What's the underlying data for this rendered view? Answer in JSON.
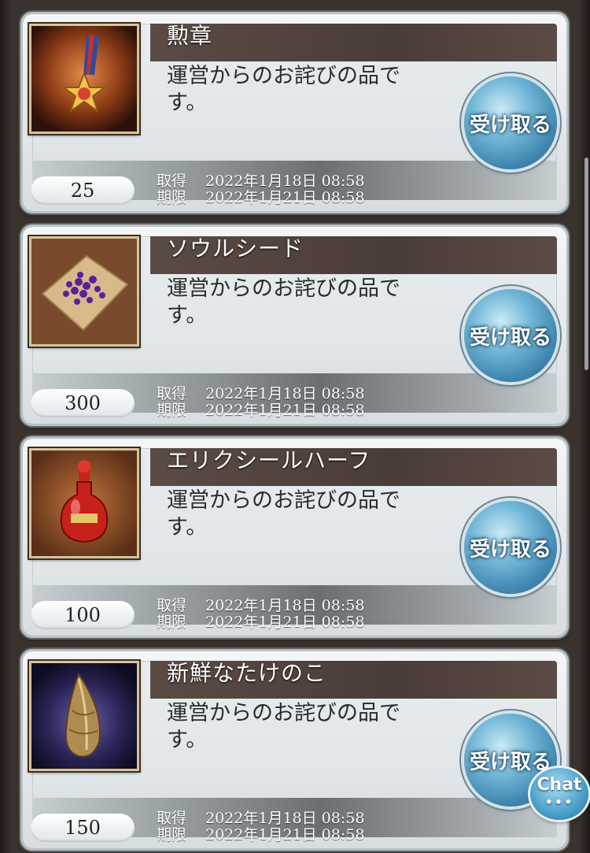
{
  "items": [
    {
      "name": "勲章",
      "description": "運営からのお詫びの品で\nす。",
      "count": "25",
      "acquired_label": "取得",
      "acquired_date": "2022年1月18日 08:58",
      "expiry_label": "期限",
      "expiry_date": "2022年1月21日 08:58",
      "claim_label": "受け取る",
      "icon": "medal-icon"
    },
    {
      "name": "ソウルシード",
      "description": "運営からのお詫びの品で\nす。",
      "count": "300",
      "acquired_label": "取得",
      "acquired_date": "2022年1月18日 08:58",
      "expiry_label": "期限",
      "expiry_date": "2022年1月21日 08:58",
      "claim_label": "受け取る",
      "icon": "soul-seed-icon"
    },
    {
      "name": "エリクシールハーフ",
      "description": "運営からのお詫びの品で\nす。",
      "count": "100",
      "acquired_label": "取得",
      "acquired_date": "2022年1月18日 08:58",
      "expiry_label": "期限",
      "expiry_date": "2022年1月21日 08:58",
      "claim_label": "受け取る",
      "icon": "elixir-bottle-icon"
    },
    {
      "name": "新鮮なたけのこ",
      "description": "運営からのお詫びの品で\nす。",
      "count": "150",
      "acquired_label": "取得",
      "acquired_date": "2022年1月18日 08:58",
      "expiry_label": "期限",
      "expiry_date": "2022年1月21日 08:58",
      "claim_label": "受け取る",
      "icon": "bamboo-shoot-icon"
    }
  ],
  "chat": {
    "label": "Chat",
    "dots": "•••"
  }
}
